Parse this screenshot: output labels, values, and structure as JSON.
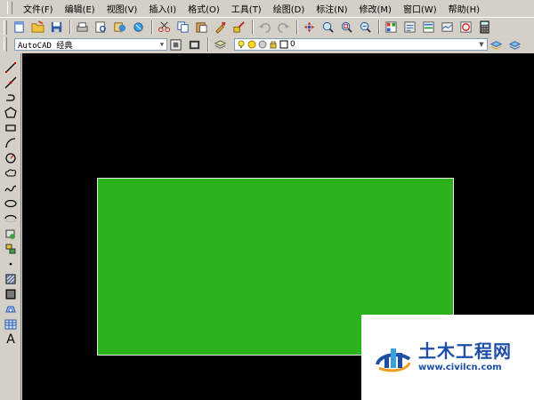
{
  "menu": [
    "文件(F)",
    "编辑(E)",
    "视图(V)",
    "插入(I)",
    "格式(O)",
    "工具(T)",
    "绘图(D)",
    "标注(N)",
    "修改(M)",
    "窗口(W)",
    "帮助(H)"
  ],
  "toolbar": {
    "icons": [
      "new-icon",
      "open-icon",
      "save-icon",
      "plot-icon",
      "plot-preview-icon",
      "publish-icon",
      "3d-dwf-icon",
      "cut-icon",
      "copy-icon",
      "paste-icon",
      "match-properties-icon",
      "block-editor-icon",
      "undo-icon",
      "redo-icon",
      "pan-icon",
      "zoom-realtime-icon",
      "zoom-window-icon",
      "zoom-previous-icon",
      "properties-icon",
      "design-center-icon",
      "tool-palettes-icon",
      "sheet-set-icon",
      "markup-icon",
      "calculator-icon"
    ]
  },
  "workspace": {
    "value": "AutoCAD 经典"
  },
  "layer": {
    "value": "0"
  },
  "draw_tools": [
    "line-icon",
    "construction-line-icon",
    "polyline-icon",
    "polygon-icon",
    "rectangle-icon",
    "arc-icon",
    "circle-icon",
    "revision-cloud-icon",
    "spline-icon",
    "ellipse-icon",
    "ellipse-arc-icon",
    "insert-block-icon",
    "make-block-icon",
    "point-icon",
    "hatch-icon",
    "gradient-icon",
    "region-icon",
    "table-icon",
    "multiline-text-icon"
  ],
  "draw_text_tool_glyph": "A",
  "colors": {
    "canvas": "#000000",
    "rectangle_fill": "#2cb21a",
    "watermark_blue": "#1d4fa8"
  },
  "watermark": {
    "title": "土木工程网",
    "url": "www.civilcn.com"
  }
}
